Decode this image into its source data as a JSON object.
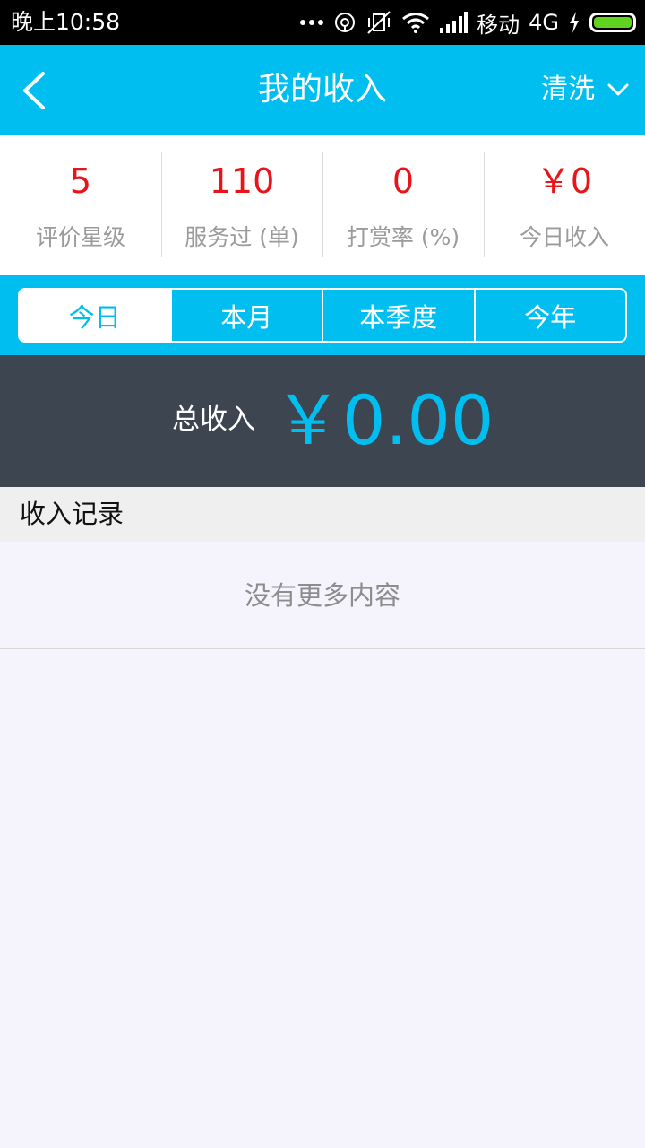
{
  "status_bar": {
    "time": "晚上10:58",
    "carrier": "移动",
    "network": "4G",
    "icons": [
      "more-dots-icon",
      "sync-icon",
      "vibrate-off-icon",
      "wifi-icon",
      "signal-icon",
      "charging-icon",
      "battery-icon"
    ],
    "battery_color": "#5fd31e"
  },
  "header": {
    "title": "我的收入",
    "service_filter": "清洗",
    "back_icon": "chevron-left-icon",
    "dropdown_icon": "chevron-down-icon",
    "background": "#00bff0"
  },
  "stats": [
    {
      "value": "5",
      "label": "评价星级"
    },
    {
      "value": "110",
      "label": "服务过 (单)"
    },
    {
      "value": "0",
      "label": "打赏率 (%)"
    },
    {
      "value": "￥0",
      "label": "今日收入"
    }
  ],
  "tabs": [
    {
      "label": "今日",
      "active": true
    },
    {
      "label": "本月",
      "active": false
    },
    {
      "label": "本季度",
      "active": false
    },
    {
      "label": "今年",
      "active": false
    }
  ],
  "total": {
    "label": "总收入",
    "amount": "￥0.00",
    "accent": "#00bff0",
    "panel_background": "#3d4550"
  },
  "records": {
    "title": "收入记录",
    "empty_text": "没有更多内容"
  },
  "colors": {
    "stat_value": "#e8141a",
    "label_gray": "#9b9b9b"
  }
}
